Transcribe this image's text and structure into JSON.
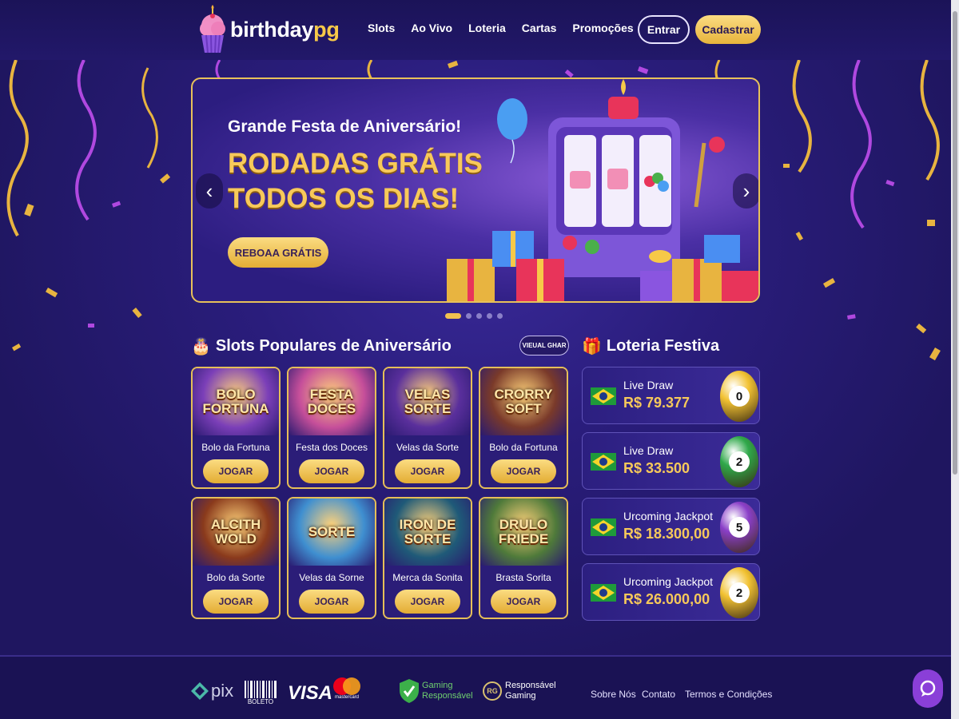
{
  "header": {
    "brand_part1": "birthday",
    "brand_part2": "pg",
    "nav": [
      "Slots",
      "Ao Vivo",
      "Loteria",
      "Cartas",
      "Promoções"
    ],
    "login_label": "Entrar",
    "register_label": "Cadastrar"
  },
  "banner": {
    "subtitle": "Grande Festa de Aniversário!",
    "headline_line1": "RODADAS GRÁTIS",
    "headline_line2": "TODOS OS DIAS!",
    "cta_label": "REBOAA GRÁTIS",
    "prev_icon": "chevron-left-icon",
    "next_icon": "chevron-right-icon",
    "slide_count": 5,
    "active_slide": 1
  },
  "slots": {
    "title": "Slots Populares de Aniversário",
    "view_all_label": "VIEUAL GHAR",
    "play_label": "JOGAR",
    "games": [
      {
        "art_line1": "BOLO",
        "art_line2": "FORTUNA",
        "name": "Bolo da Fortuna",
        "bg": "#7b3fb8"
      },
      {
        "art_line1": "FESTA",
        "art_line2": "DOCES",
        "name": "Festa dos Doces",
        "bg": "#c64f9a"
      },
      {
        "art_line1": "VELAS",
        "art_line2": "SORTE",
        "name": "Velas da Sorte",
        "bg": "#5a2f9c"
      },
      {
        "art_line1": "CRORRY",
        "art_line2": "SOFT",
        "name": "Bolo da Fortuna",
        "bg": "#7a3a2a"
      },
      {
        "art_line1": "ALCITH",
        "art_line2": "WOLD",
        "name": "Bolo da Sorte",
        "bg": "#8a3a1c"
      },
      {
        "art_line1": "",
        "art_line2": "SORTE",
        "name": "Velas da Sorne",
        "bg": "#3f8fd0"
      },
      {
        "art_line1": "IRON DE",
        "art_line2": "SORTE",
        "name": "Merca da Sonita",
        "bg": "#1f5a78"
      },
      {
        "art_line1": "DRULO",
        "art_line2": "FRIEDE",
        "name": "Brasta Sorita",
        "bg": "#4f7a3a"
      }
    ]
  },
  "lottery": {
    "title": "Loteria Festiva",
    "items": [
      {
        "label": "Live Draw",
        "amount": "R$ 79.377",
        "ball": "0",
        "ball_color": "#f2c233"
      },
      {
        "label": "Live Draw",
        "amount": "R$ 33.500",
        "ball": "2",
        "ball_color": "#2fa84a"
      },
      {
        "label": "Urcoming Jackpot",
        "amount": "R$ 18.300,00",
        "ball": "5",
        "ball_color": "#8a3fc8"
      },
      {
        "label": "Urcoming Jackpot",
        "amount": "R$ 26.000,00",
        "ball": "2",
        "ball_color": "#f2c233"
      }
    ]
  },
  "footer": {
    "pix_label": "pix",
    "boleto_label": "BOLETO",
    "visa_label": "VISA",
    "mastercard_label": "mastercard",
    "gaming_responsible_line1": "Gaming",
    "gaming_responsible_line2": "Responsável",
    "rg_line1": "Responsável",
    "rg_line2": "Gaming",
    "rg_badge": "RG",
    "links": [
      "Sobre Nós",
      "Contato",
      "Termos e Condições"
    ]
  },
  "colors": {
    "accent_gold": "#f2c24f",
    "background": "#1f1660",
    "chat_button": "#8a3fd8"
  }
}
